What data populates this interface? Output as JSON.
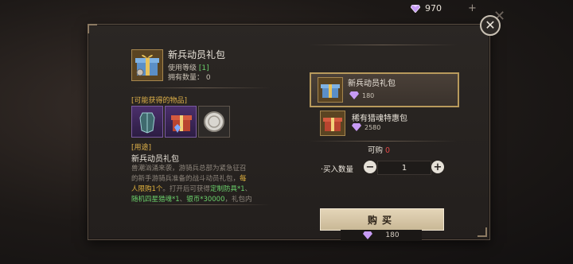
{
  "topbar": {
    "gem_icon": "diamond-icon",
    "gem_amount": "970",
    "add_symbol": "+"
  },
  "panel": {
    "close_symbol": "✕"
  },
  "item": {
    "name": "新兵动员礼包",
    "use_level_label": "使用等级",
    "use_level_value": "[1]",
    "owned_label": "拥有数量：",
    "owned_value": "0",
    "icon": "gift-box-icon"
  },
  "rewards": {
    "label": "[可能获得的物品]",
    "items": [
      {
        "icon": "armor-icon",
        "frame": "purple"
      },
      {
        "icon": "gift-box-icon",
        "frame": "purple"
      },
      {
        "icon": "silver-coin-icon",
        "frame": "grey"
      }
    ]
  },
  "usage": {
    "label": "[用途]",
    "title": "新兵动员礼包",
    "desc_line1": "兽潮汹涌来袭，游骑兵总部为紧急征召",
    "desc_line2a": "的新手游骑兵准备的战斗动员礼包，",
    "desc_line2b": "每",
    "desc_line3a": "人限购1个",
    "desc_line3b": "。打开后可获得",
    "desc_line3c": "定制防具*1",
    "desc_line3d": "、",
    "desc_line4a": "随机四星猎魂*1",
    "desc_line4b": "、",
    "desc_line4c": "银币*30000",
    "desc_line4d": "，礼包内"
  },
  "store": {
    "selected": {
      "name": "新兵动员礼包",
      "price": "180",
      "icon": "gift-box-icon"
    },
    "other": {
      "name": "稀有猎魂特惠包",
      "price": "2580",
      "icon": "gift-box-icon"
    }
  },
  "purchase": {
    "can_buy_label": "可购",
    "can_buy_value": "0",
    "qty_label": "·买入数量",
    "qty_value": "1",
    "minus": "−",
    "plus": "+",
    "buy_label": "购买",
    "total_price": "180"
  },
  "colors": {
    "accent_gold": "#b89a5c",
    "highlight_yellow": "#e2b23e",
    "highlight_green": "#6bd16b",
    "warning_red": "#e04848"
  }
}
